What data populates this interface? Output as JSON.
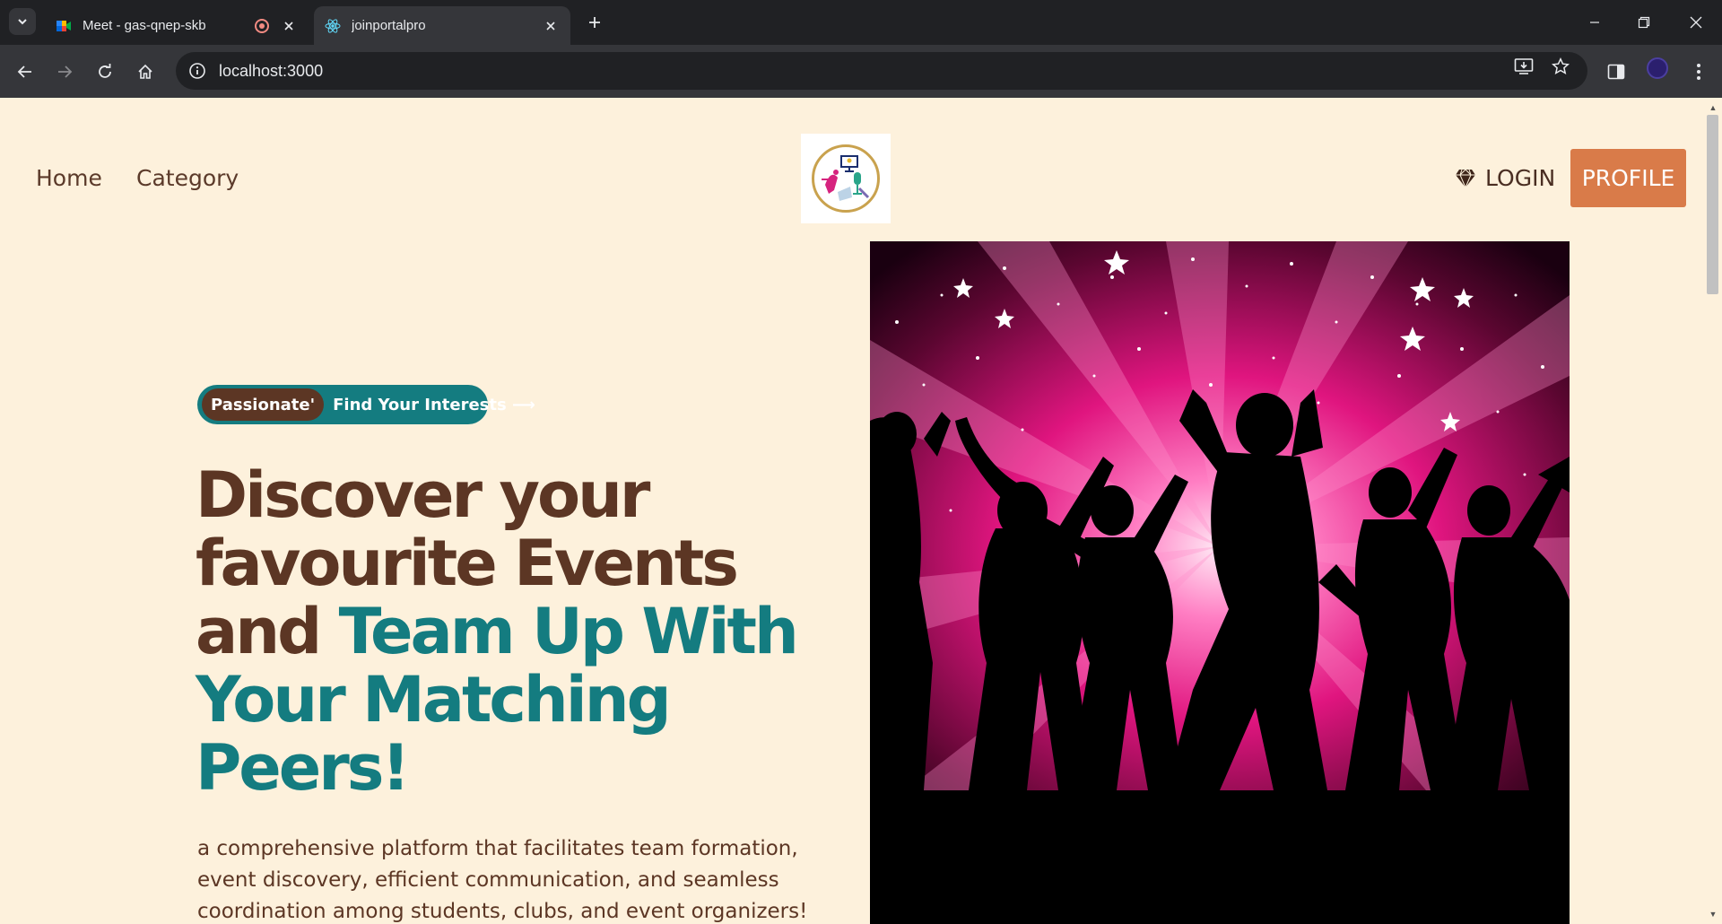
{
  "browser": {
    "tabs": [
      {
        "title": "Meet - gas-qnep-skb",
        "active": false
      },
      {
        "title": "joinportalpro",
        "active": true
      }
    ],
    "url": "localhost:3000"
  },
  "nav": {
    "links": [
      "Home",
      "Category"
    ],
    "login_label": "LOGIN",
    "profile_label": "PROFILE"
  },
  "hero": {
    "badge_tag": "Passionate'",
    "badge_cta": "Find Your Interests ⟶",
    "title_part1": "Discover your favourite Events and ",
    "title_part2": "Team Up With Your Matching Peers!",
    "description": "a comprehensive platform that facilitates team formation, event discovery, efficient communication, and seamless coordination among students, clubs, and event organizers!"
  },
  "colors": {
    "background": "#fdf1dc",
    "brown": "#5c3624",
    "teal": "#147c80",
    "profile_button": "#d97b49",
    "hero_pink": "#e0157f"
  }
}
